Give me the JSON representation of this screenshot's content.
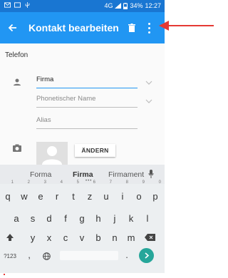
{
  "status_bar": {
    "network": "4G",
    "battery": "34%",
    "time": "12:27"
  },
  "app_bar": {
    "title": "Kontakt bearbeiten",
    "back_icon": "arrow-back-icon",
    "delete_icon": "trash-icon",
    "overflow_icon": "more-vert-icon",
    "color": "#2196f3",
    "status_color": "#1976d2"
  },
  "form": {
    "section_label": "Telefon",
    "fields": [
      {
        "value": "Firma",
        "placeholder": "",
        "active": true
      },
      {
        "value": "",
        "placeholder": "Phonetischer Name",
        "active": false
      },
      {
        "value": "",
        "placeholder": "Alias",
        "active": false
      }
    ],
    "change_button": "ÄNDERN"
  },
  "keyboard": {
    "suggestions": [
      "Forma",
      "Firma",
      "Firmament"
    ],
    "row1": [
      {
        "key": "q",
        "hint": "1"
      },
      {
        "key": "w",
        "hint": "2"
      },
      {
        "key": "e",
        "hint": "3"
      },
      {
        "key": "r",
        "hint": "4"
      },
      {
        "key": "t",
        "hint": "5"
      },
      {
        "key": "z",
        "hint": "6"
      },
      {
        "key": "u",
        "hint": "7"
      },
      {
        "key": "i",
        "hint": "8"
      },
      {
        "key": "o",
        "hint": "9"
      },
      {
        "key": "p",
        "hint": "0"
      }
    ],
    "row2": [
      "a",
      "s",
      "d",
      "f",
      "g",
      "h",
      "j",
      "k",
      "l"
    ],
    "row3": [
      "y",
      "x",
      "c",
      "v",
      "b",
      "n",
      "m"
    ],
    "symbols_key": "?123",
    "comma_key": ",",
    "period_key": ".",
    "accent_color": "#26a69a"
  },
  "annotation": {
    "arrow_color": "#e53935"
  }
}
